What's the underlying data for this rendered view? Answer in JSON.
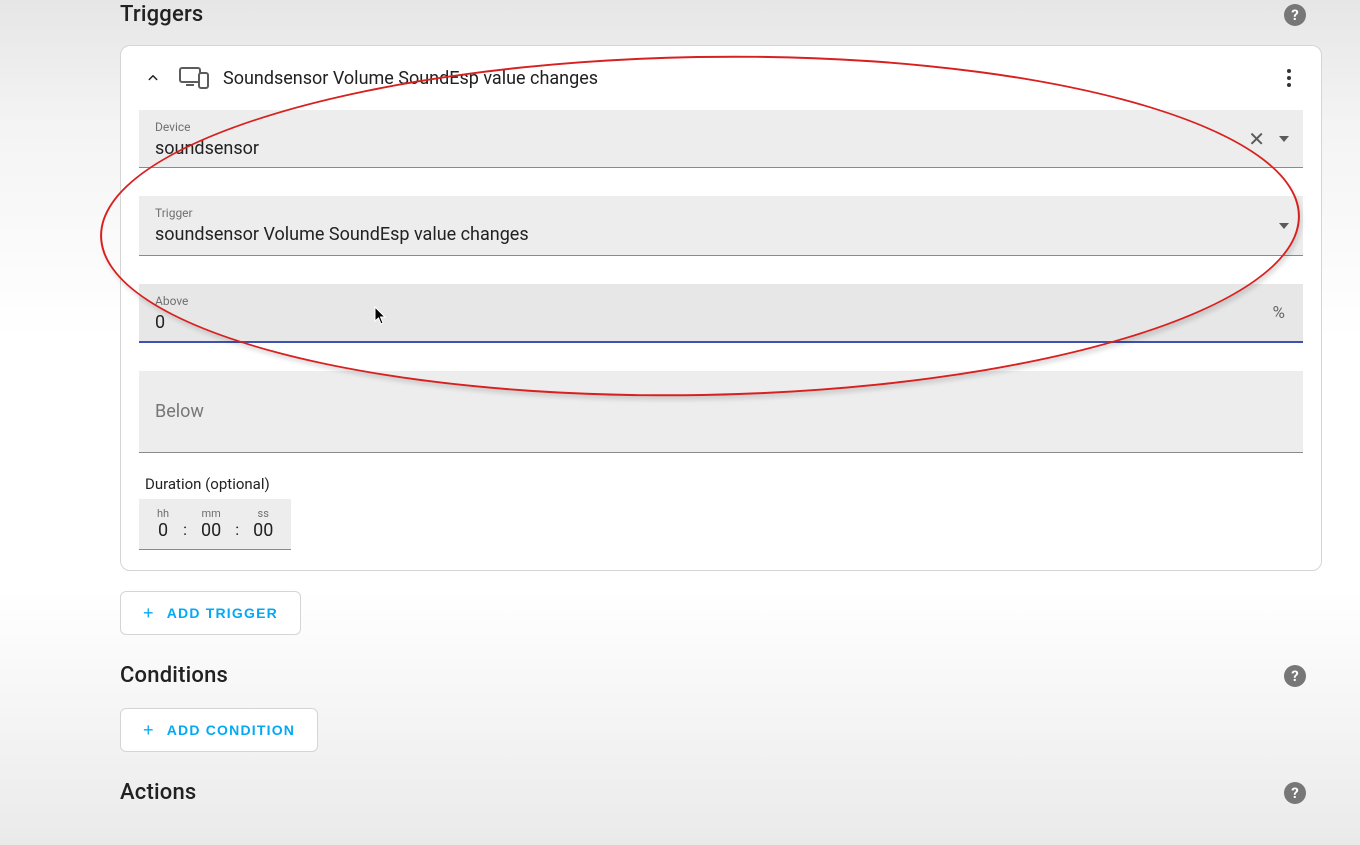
{
  "sections": {
    "triggers_title": "Triggers",
    "conditions_title": "Conditions",
    "actions_title": "Actions"
  },
  "trigger_card": {
    "title": "Soundsensor Volume SoundEsp value changes",
    "device_field": {
      "label": "Device",
      "value": "soundsensor"
    },
    "trigger_field": {
      "label": "Trigger",
      "value": "soundsensor Volume SoundEsp value changes"
    },
    "above_field": {
      "label": "Above",
      "value": "0",
      "suffix": "%"
    },
    "below_field": {
      "label": "Below",
      "value": ""
    },
    "duration": {
      "label": "Duration (optional)",
      "hh_label": "hh",
      "hh": "0",
      "mm_label": "mm",
      "mm": "00",
      "ss_label": "ss",
      "ss": "00"
    }
  },
  "buttons": {
    "add_trigger": "ADD TRIGGER",
    "add_condition": "ADD CONDITION"
  }
}
